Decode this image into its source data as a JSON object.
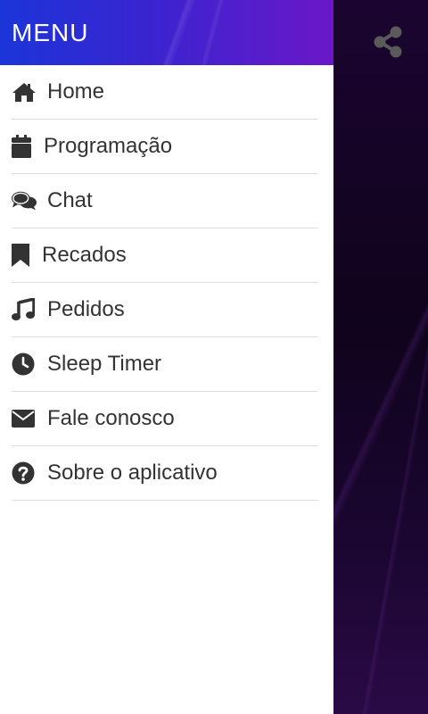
{
  "header": {
    "title": "MENU"
  },
  "menu": {
    "items": [
      {
        "label": "Home",
        "icon": "home-icon"
      },
      {
        "label": "Programação",
        "icon": "calendar-icon"
      },
      {
        "label": "Chat",
        "icon": "chat-icon"
      },
      {
        "label": "Recados",
        "icon": "bookmark-icon"
      },
      {
        "label": "Pedidos",
        "icon": "music-note-icon"
      },
      {
        "label": "Sleep Timer",
        "icon": "clock-icon"
      },
      {
        "label": "Fale conosco",
        "icon": "envelope-icon"
      },
      {
        "label": "Sobre o aplicativo",
        "icon": "question-circle-icon"
      }
    ]
  },
  "toolbar": {
    "share_icon": "share-icon"
  },
  "colors": {
    "header_start": "#1c35d8",
    "header_end": "#6a18c8",
    "text": "#333333",
    "divider": "#dddddd",
    "backdrop": "#14041f"
  }
}
